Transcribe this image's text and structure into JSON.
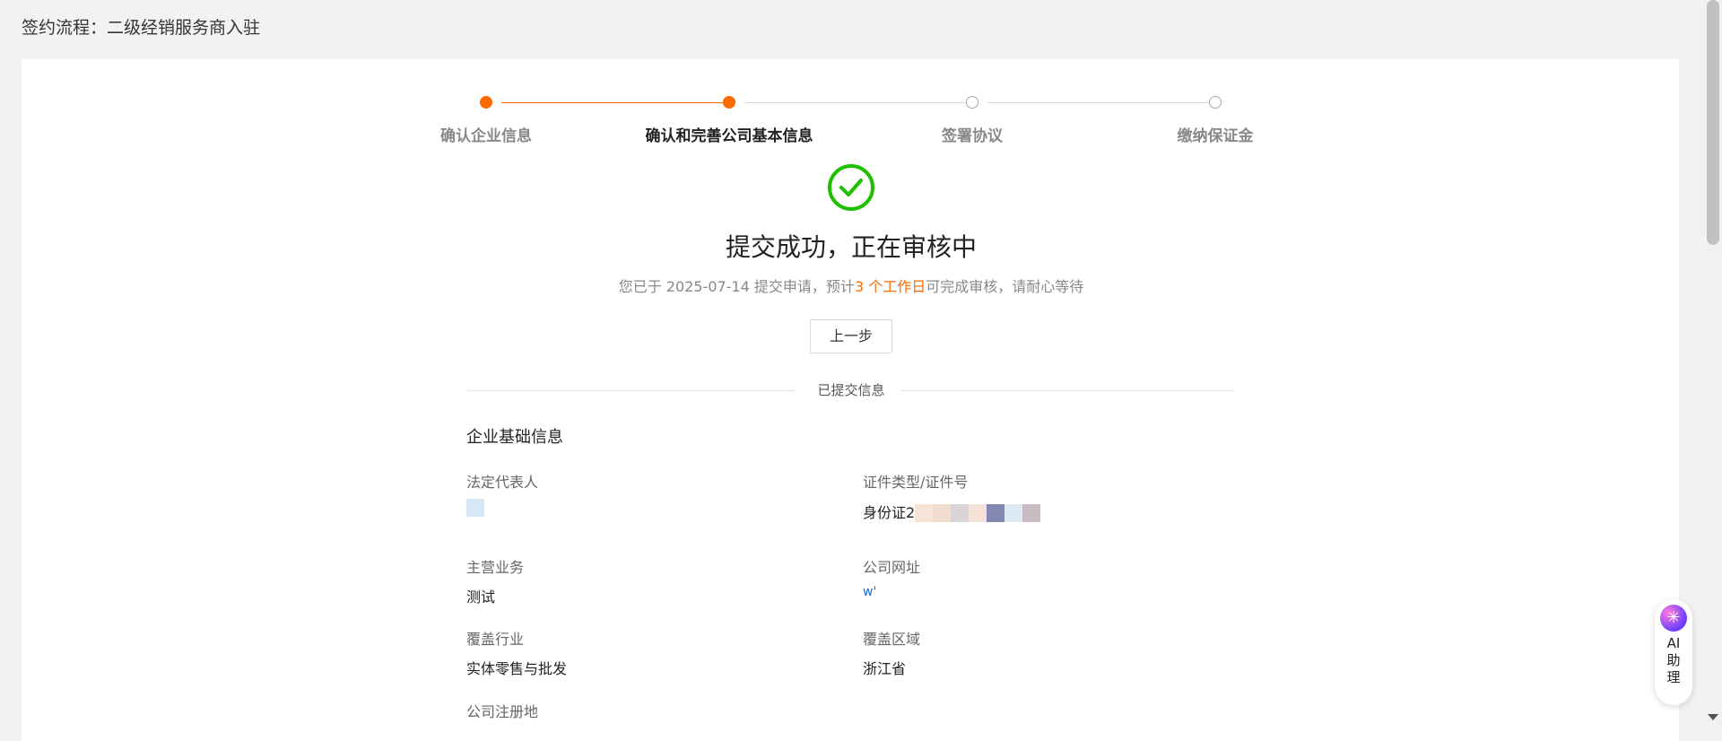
{
  "header": {
    "title": "签约流程：二级经销服务商入驻"
  },
  "steps": [
    {
      "label": "确认企业信息",
      "status": "done"
    },
    {
      "label": "确认和完善公司基本信息",
      "status": "current"
    },
    {
      "label": "签署协议",
      "status": "todo"
    },
    {
      "label": "缴纳保证金",
      "status": "todo"
    }
  ],
  "result": {
    "title": "提交成功，正在审核中",
    "sub_prefix": "您已于 2025-07-14 提交申请，预计",
    "sub_highlight": "3 个工作日",
    "sub_suffix": "可完成审核，请耐心等待",
    "prev_button": "上一步"
  },
  "submitted": {
    "divider": "已提交信息",
    "section_title": "企业基础信息",
    "fields": {
      "legal_rep_label": "法定代表人",
      "id_label": "证件类型/证件号",
      "id_value": "身份证2",
      "business_label": "主营业务",
      "business_value": "测试",
      "website_label": "公司网址",
      "website_value": "w'",
      "industry_label": "覆盖行业",
      "industry_value": "实体零售与批发",
      "region_label": "覆盖区域",
      "region_value": "浙江省",
      "reg_address_label": "公司注册地"
    }
  },
  "ai_helper": {
    "text": "AI\n助\n理"
  },
  "colors": {
    "accent": "#ff6a00",
    "success": "#1fc000",
    "link": "#1a66d1"
  }
}
